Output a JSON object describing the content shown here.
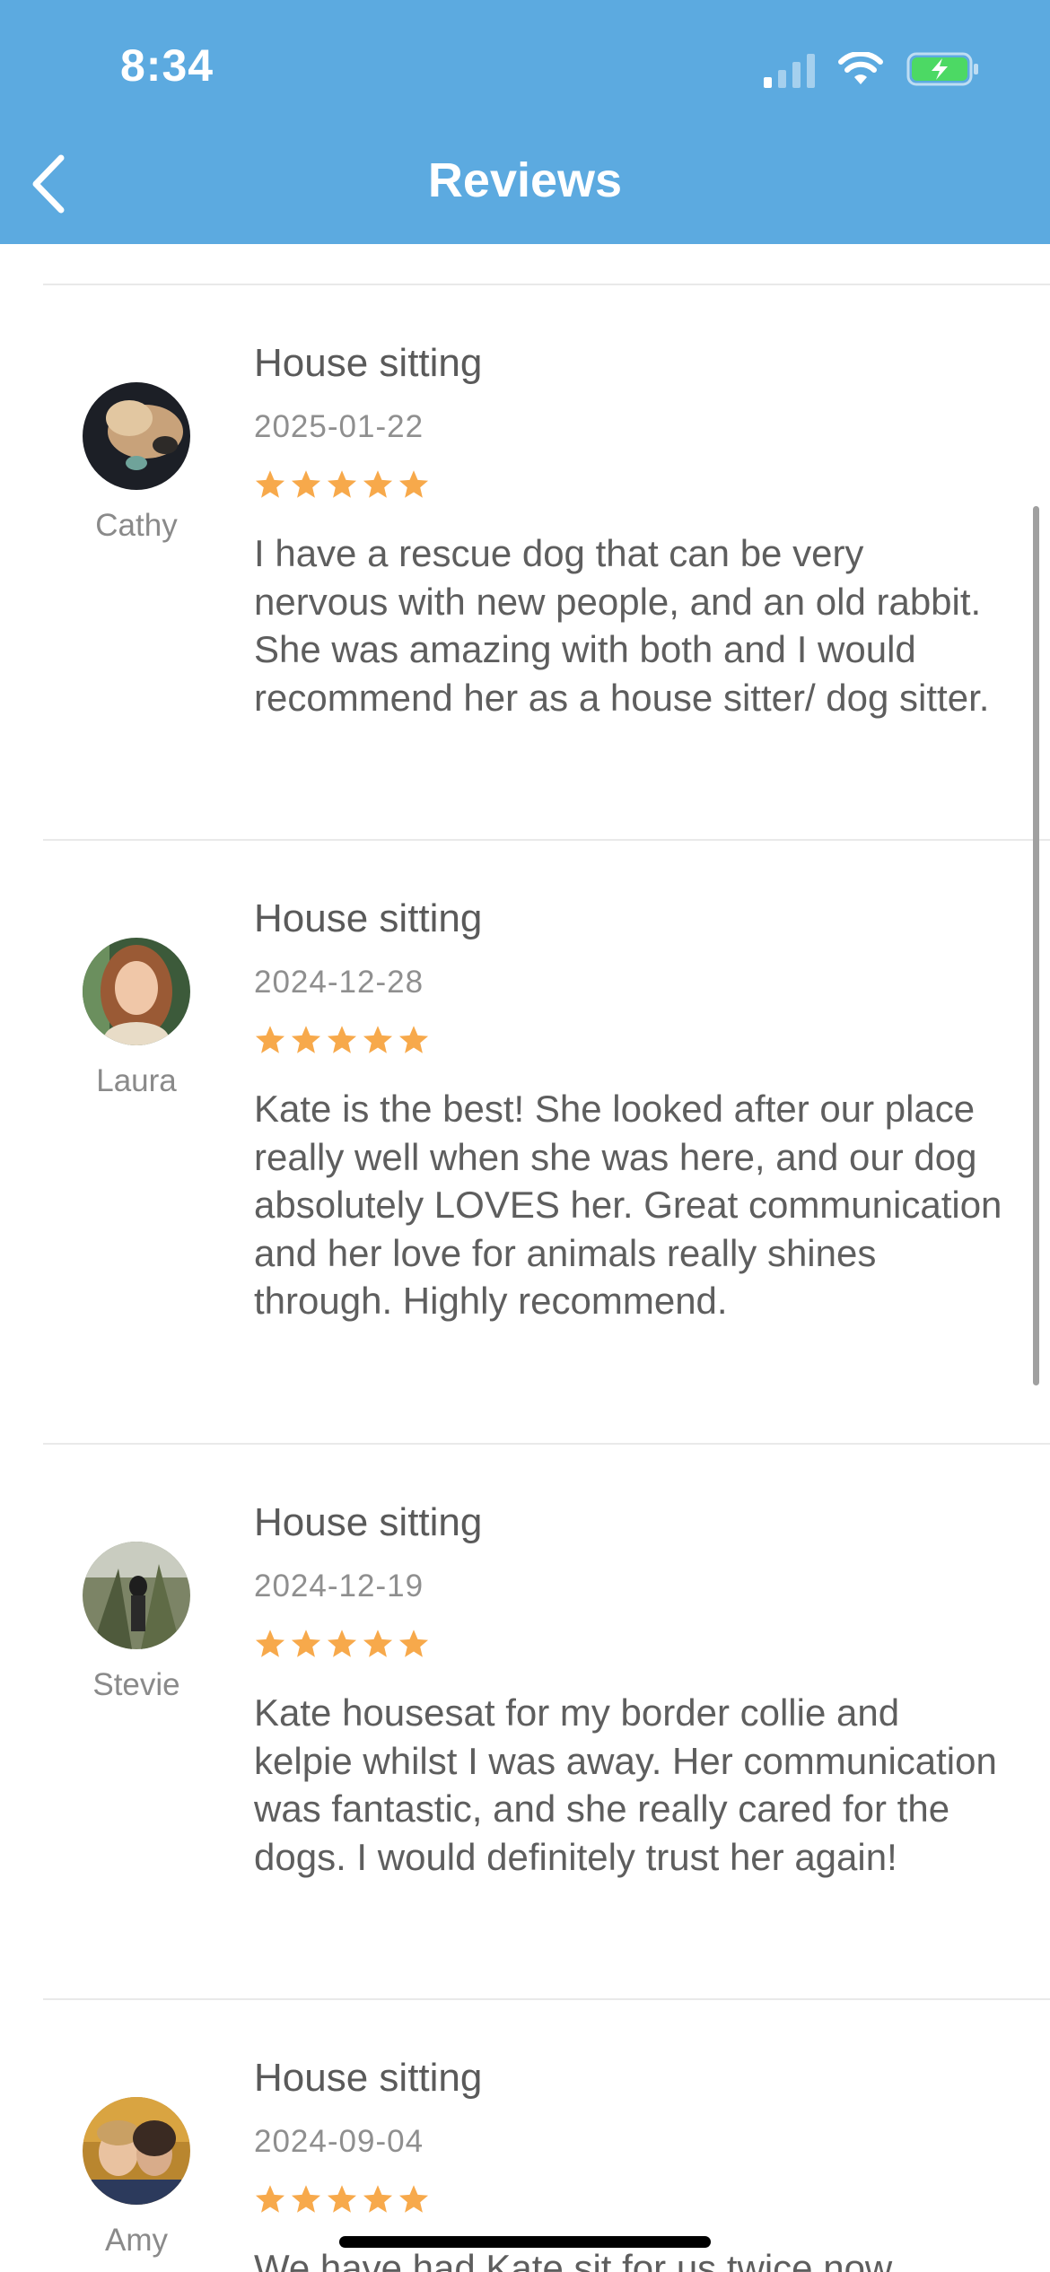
{
  "status_bar": {
    "time": "8:34"
  },
  "nav": {
    "title": "Reviews",
    "back_icon": "chevron-left-icon"
  },
  "colors": {
    "header": "#5caae0",
    "star": "#f7a94b",
    "battery": "#4cd964"
  },
  "reviews": [
    {
      "reviewer": "Cathy",
      "service": "House sitting",
      "date": "2025-01-22",
      "rating": 5,
      "text": "I have a rescue dog that can be very nervous with new people, and an old rabbit. She was amazing with both and I would recommend her as a house sitter/ dog sitter."
    },
    {
      "reviewer": "Laura",
      "service": "House sitting",
      "date": "2024-12-28",
      "rating": 5,
      "text": "Kate is the best! She looked after our place really well when she was here, and our dog absolutely LOVES her. Great communication and her love for animals really shines through. Highly recommend."
    },
    {
      "reviewer": "Stevie",
      "service": "House sitting",
      "date": "2024-12-19",
      "rating": 5,
      "text": "Kate housesat for my border collie and kelpie whilst I was away. Her communication was fantastic, and she really cared for the dogs. I would definitely trust her again!"
    },
    {
      "reviewer": "Amy",
      "service": "House sitting",
      "date": "2024-09-04",
      "rating": 5,
      "text": "We have had Kate sit for us twice now"
    }
  ]
}
